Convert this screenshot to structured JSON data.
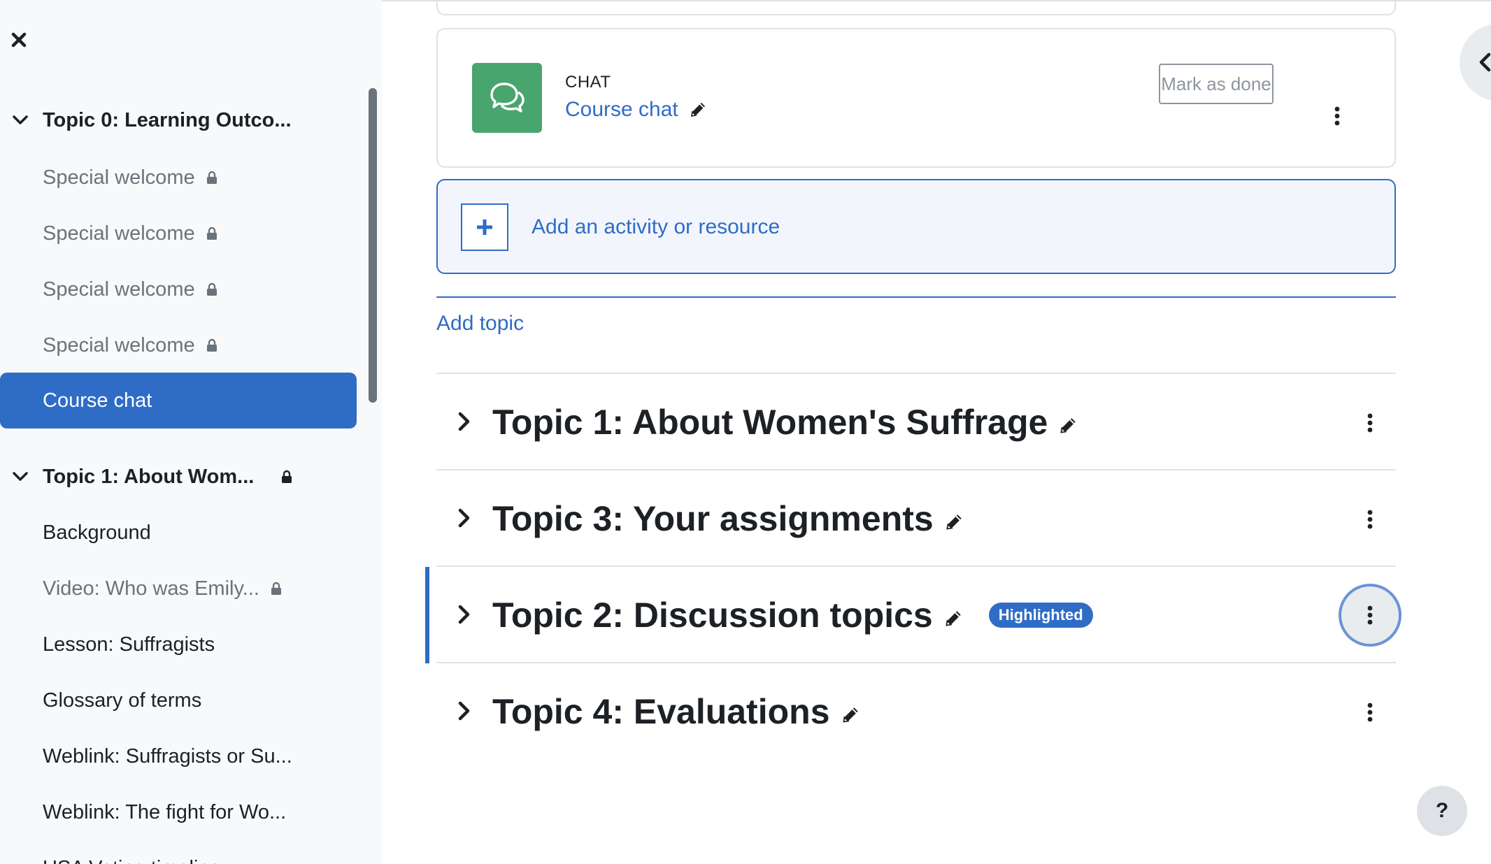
{
  "course_index": {
    "close_icon": "close-icon",
    "sections": [
      {
        "title": "Topic 0: Learning Outco...",
        "expanded": true,
        "locked": false,
        "items": [
          {
            "label": "Special welcome",
            "locked": true,
            "dim": true
          },
          {
            "label": "Special welcome",
            "locked": true,
            "dim": true
          },
          {
            "label": "Special welcome",
            "locked": true,
            "dim": true
          },
          {
            "label": "Special welcome",
            "locked": true,
            "dim": true
          },
          {
            "label": "Course chat",
            "locked": false,
            "active": true
          }
        ]
      },
      {
        "title": "Topic 1: About Wom...",
        "expanded": true,
        "locked": true,
        "items": [
          {
            "label": "Background",
            "locked": false
          },
          {
            "label": "Video: Who was Emily...",
            "locked": true,
            "dim": true
          },
          {
            "label": "Lesson: Suffragists",
            "locked": false
          },
          {
            "label": "Glossary of terms",
            "locked": false
          },
          {
            "label": "Weblink: Suffragists or Su...",
            "locked": false
          },
          {
            "label": "Weblink: The fight for Wo...",
            "locked": false
          },
          {
            "label": "USA Voting timeline",
            "locked": false
          }
        ]
      }
    ]
  },
  "activity": {
    "type_label": "CHAT",
    "name": "Course chat",
    "icon": "chat-bubbles-icon",
    "mark_done_label": "Mark as done"
  },
  "add_activity_label": "Add an activity or resource",
  "add_topic_label": "Add topic",
  "sections": [
    {
      "title": "Topic 1: About Women's Suffrage",
      "highlighted": false
    },
    {
      "title": "Topic 3: Your assignments",
      "highlighted": false
    },
    {
      "title": "Topic 2: Discussion topics",
      "highlighted": true,
      "badge": "Highlighted"
    },
    {
      "title": "Topic 4: Evaluations",
      "highlighted": false
    }
  ],
  "help_label": "?",
  "colors": {
    "primary": "#2f6cc6",
    "chat_icon_bg": "#48a56d",
    "drawer_bg": "#f8f9fa"
  }
}
